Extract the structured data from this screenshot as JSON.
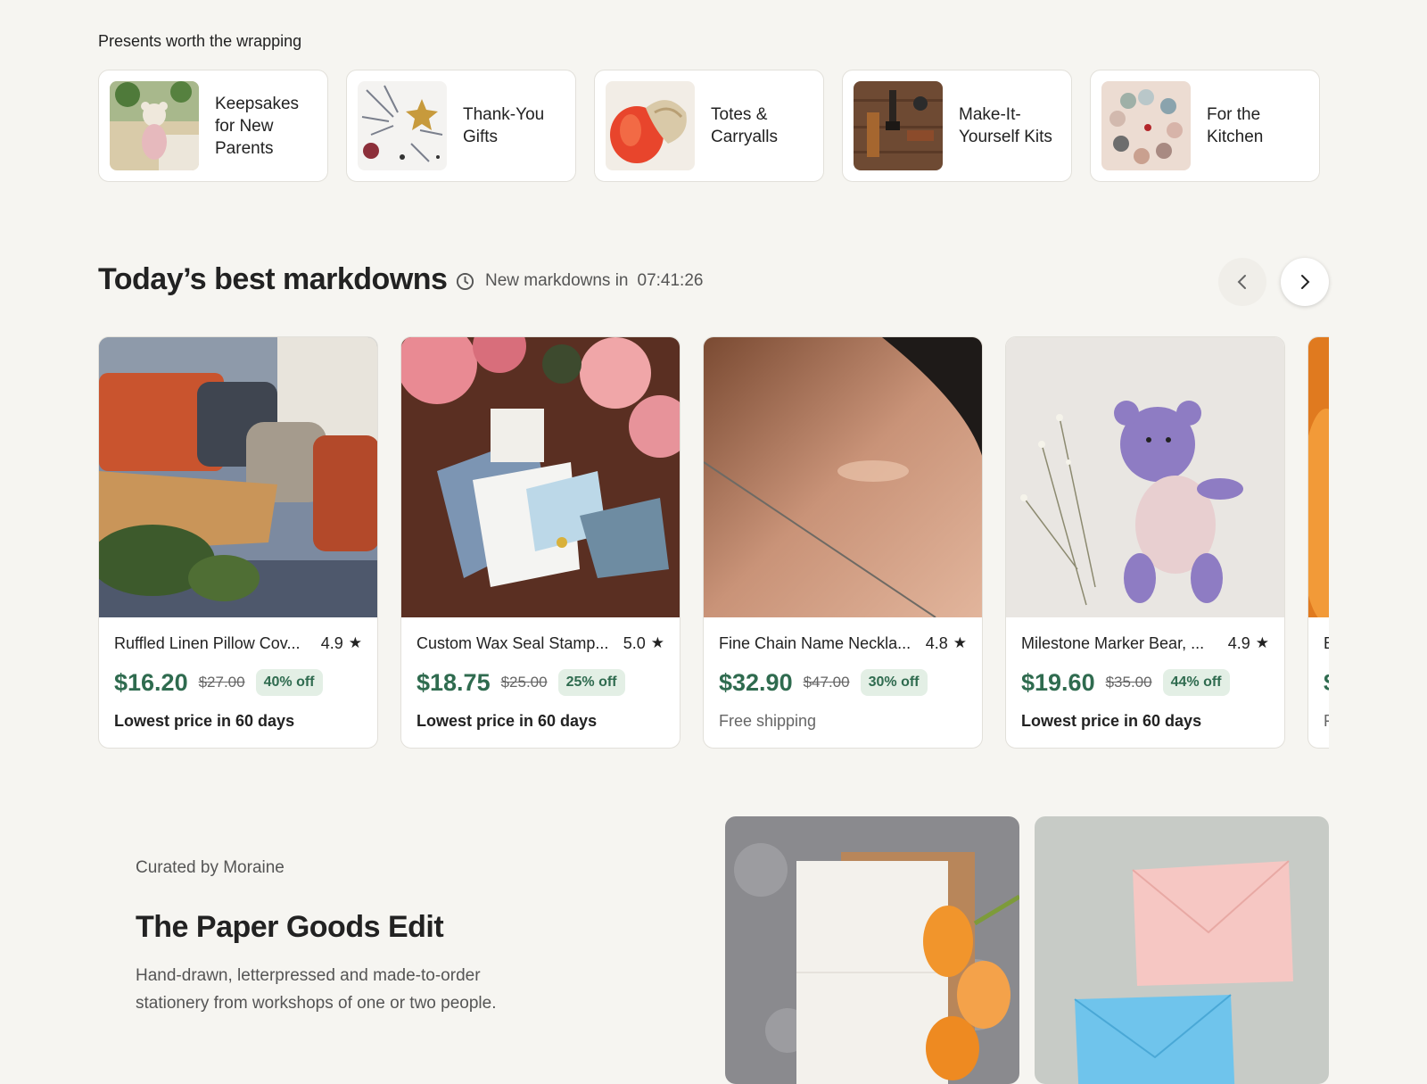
{
  "gifts": {
    "heading": "Presents worth the wrapping",
    "items": [
      {
        "label": "Keepsakes for New Parents"
      },
      {
        "label": "Thank-You Gifts"
      },
      {
        "label": "Totes & Carryalls"
      },
      {
        "label": "Make-It-Yourself Kits"
      },
      {
        "label": "For the Kitchen"
      }
    ]
  },
  "markdowns": {
    "title": "Today’s best markdowns",
    "countdown_label": "New markdowns in",
    "countdown_time": "07:41:26",
    "icons": {
      "clock": "clock-icon",
      "prev": "chevron-left-icon",
      "next": "chevron-right-icon",
      "star": "star-icon"
    },
    "products": [
      {
        "name": "Ruffled Linen Pillow Cov...",
        "rating": "4.9",
        "price": "$16.20",
        "original_price": "$27.00",
        "discount": "40% off",
        "note": "Lowest price in 60 days"
      },
      {
        "name": "Custom Wax Seal Stamp...",
        "rating": "5.0",
        "price": "$18.75",
        "original_price": "$25.00",
        "discount": "25% off",
        "note": "Lowest price in 60 days"
      },
      {
        "name": "Fine Chain Name Neckla...",
        "rating": "4.8",
        "price": "$32.90",
        "original_price": "$47.00",
        "discount": "30% off",
        "note": "Free shipping"
      },
      {
        "name": "Milestone Marker Bear, ...",
        "rating": "4.9",
        "price": "$19.60",
        "original_price": "$35.00",
        "discount": "44% off",
        "note": "Lowest price in 60 days"
      },
      {
        "name": "B",
        "rating": "",
        "price": "$",
        "original_price": "",
        "discount": "",
        "note": "F"
      }
    ]
  },
  "edit": {
    "curated_by": "Curated by Moraine",
    "title": "The Paper Goods Edit",
    "description": "Hand-drawn, letterpressed and made-to-order stationery from workshops of one or two people."
  },
  "colors": {
    "background": "#f6f5f1",
    "price_green": "#2f6b4f",
    "discount_bg": "#e3efe5"
  }
}
